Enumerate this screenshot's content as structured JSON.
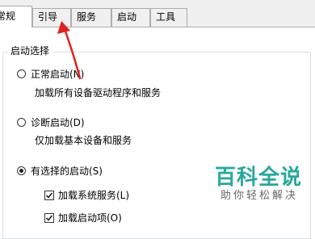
{
  "tabs": [
    {
      "label": "常规",
      "active": true
    },
    {
      "label": "引导",
      "active": false
    },
    {
      "label": "服务",
      "active": false
    },
    {
      "label": "启动",
      "active": false
    },
    {
      "label": "工具",
      "active": false
    }
  ],
  "startup": {
    "group_title": "启动选择",
    "normal": {
      "label": "正常启动(N)",
      "desc": "加载所有设备驱动程序和服务",
      "checked": false
    },
    "diagnostic": {
      "label": "诊断启动(D)",
      "desc": "仅加载基本设备和服务",
      "checked": false
    },
    "selective": {
      "label": "有选择的启动(S)",
      "checked": true
    },
    "load_system_services": {
      "label": "加载系统服务(L)",
      "checked": true
    },
    "load_startup_items": {
      "label": "加载启动项(O)",
      "checked": true
    }
  },
  "annotation": {
    "color": "#e02020"
  },
  "watermark": {
    "title": "百科全说",
    "subtitle": "助你轻松解决"
  }
}
